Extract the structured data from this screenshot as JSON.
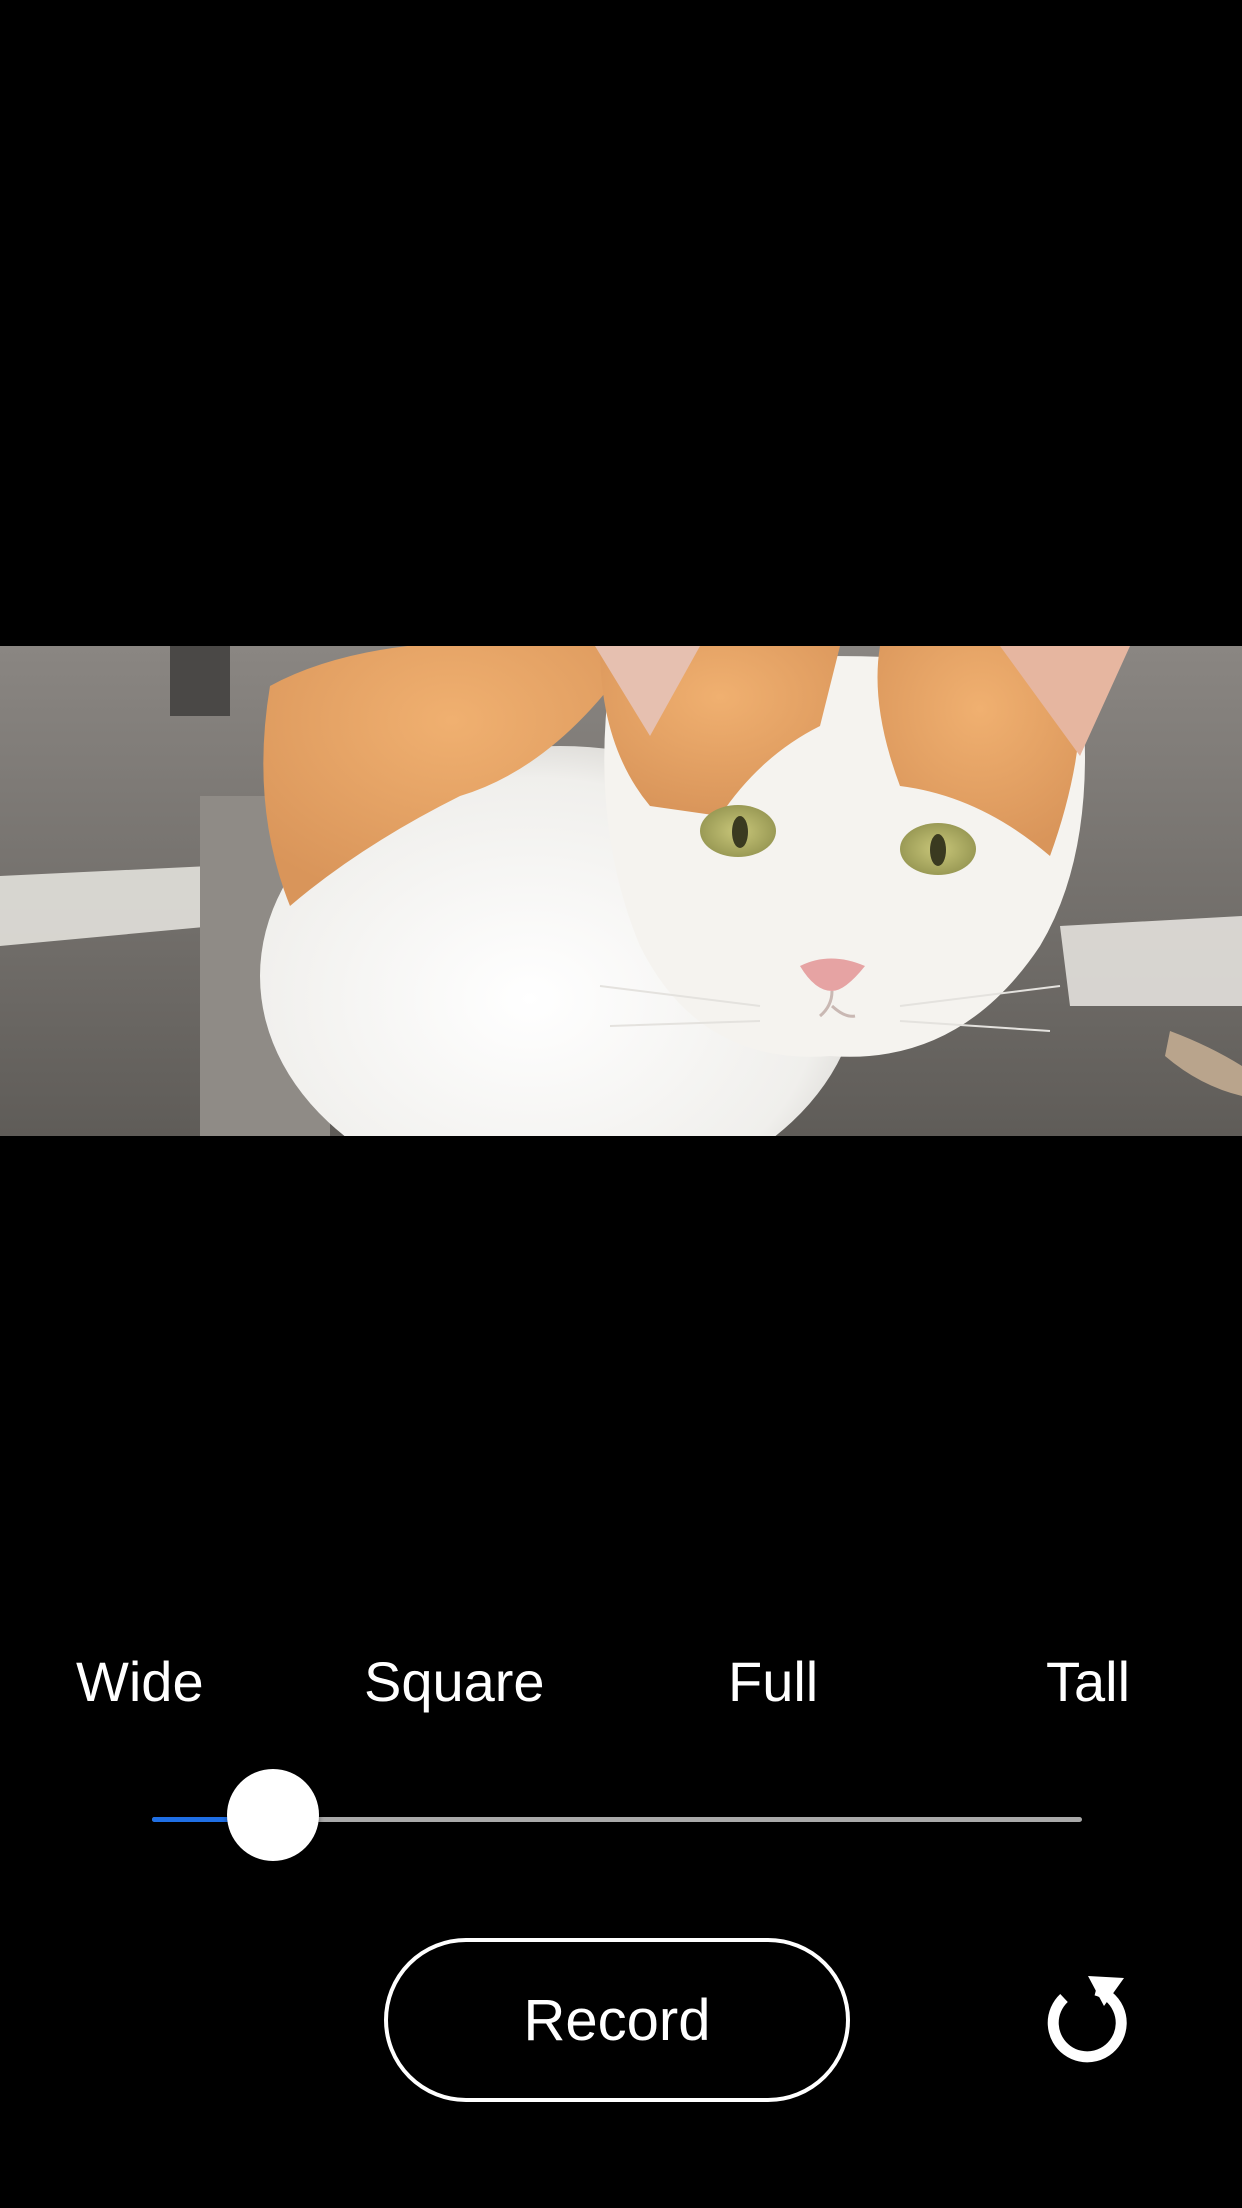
{
  "preview": {
    "subject": "cat-photo"
  },
  "aspect_options": {
    "labels": [
      "Wide",
      "Square",
      "Full",
      "Tall"
    ],
    "slider_value": 0.13
  },
  "controls": {
    "record_label": "Record",
    "reset_icon": "rotate-ccw-icon"
  },
  "colors": {
    "background": "#000000",
    "slider_active": "#1f6fe5",
    "slider_inactive": "#a9a9a9",
    "foreground": "#ffffff"
  }
}
